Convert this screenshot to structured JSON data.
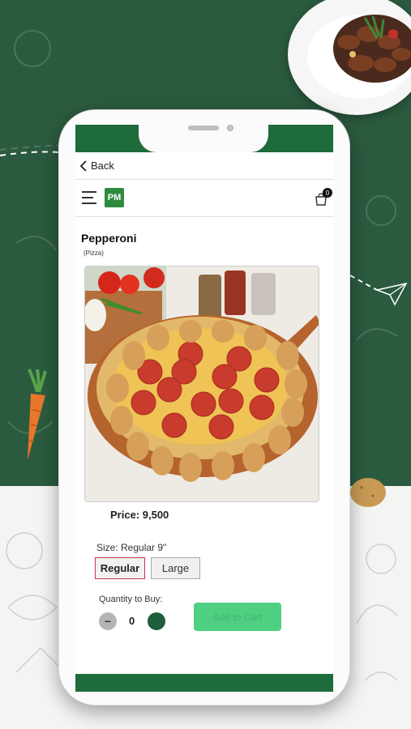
{
  "header": {
    "back_label": "Back",
    "cart_count": "0",
    "logo_text": "PM"
  },
  "product": {
    "name": "Pepperoni",
    "category": "(Pizza)",
    "price": "Price: 9,500"
  },
  "size": {
    "label": "Size: Regular 9\"",
    "options": [
      "Regular",
      "Large"
    ],
    "selected": "Regular"
  },
  "quantity": {
    "label": "Quantity to Buy:",
    "minus": "−",
    "value": "0"
  },
  "actions": {
    "add_to_cart": "Add to Cart"
  },
  "colors": {
    "brand_green": "#1e6b3c",
    "accent_button": "#4fcf81",
    "selected_border": "#c0394b"
  }
}
